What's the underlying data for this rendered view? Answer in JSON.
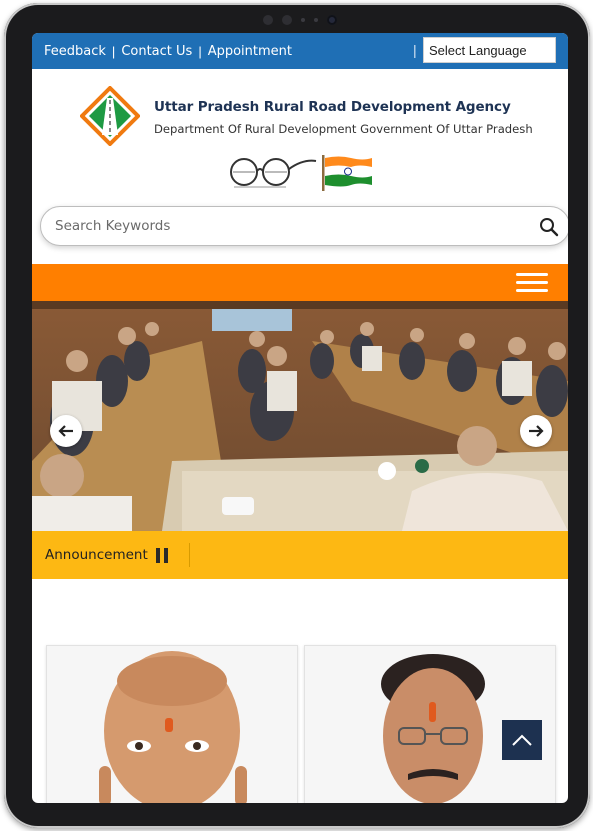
{
  "topbar": {
    "links": [
      "Feedback",
      "Contact Us",
      "Appointment"
    ],
    "separator": "|",
    "language_select": "Select Language"
  },
  "header": {
    "title": "Uttar Pradesh Rural Road Development Agency",
    "subtitle": "Department Of Rural Development Government Of Uttar Pradesh"
  },
  "search": {
    "placeholder": "Search Keywords"
  },
  "announcement": {
    "label": "Announcement"
  },
  "icons": [
    "agency-logo-icon",
    "swachh-bharat-icon",
    "india-flag-icon",
    "search-icon",
    "menu-icon",
    "arrow-left-icon",
    "arrow-right-icon",
    "pause-icon",
    "chevron-up-icon"
  ],
  "colors": {
    "topbar": "#1f6fb5",
    "nav": "#ff7f00",
    "announcement": "#fdb813",
    "title": "#1e3354",
    "back_to_top": "#1d3150"
  }
}
